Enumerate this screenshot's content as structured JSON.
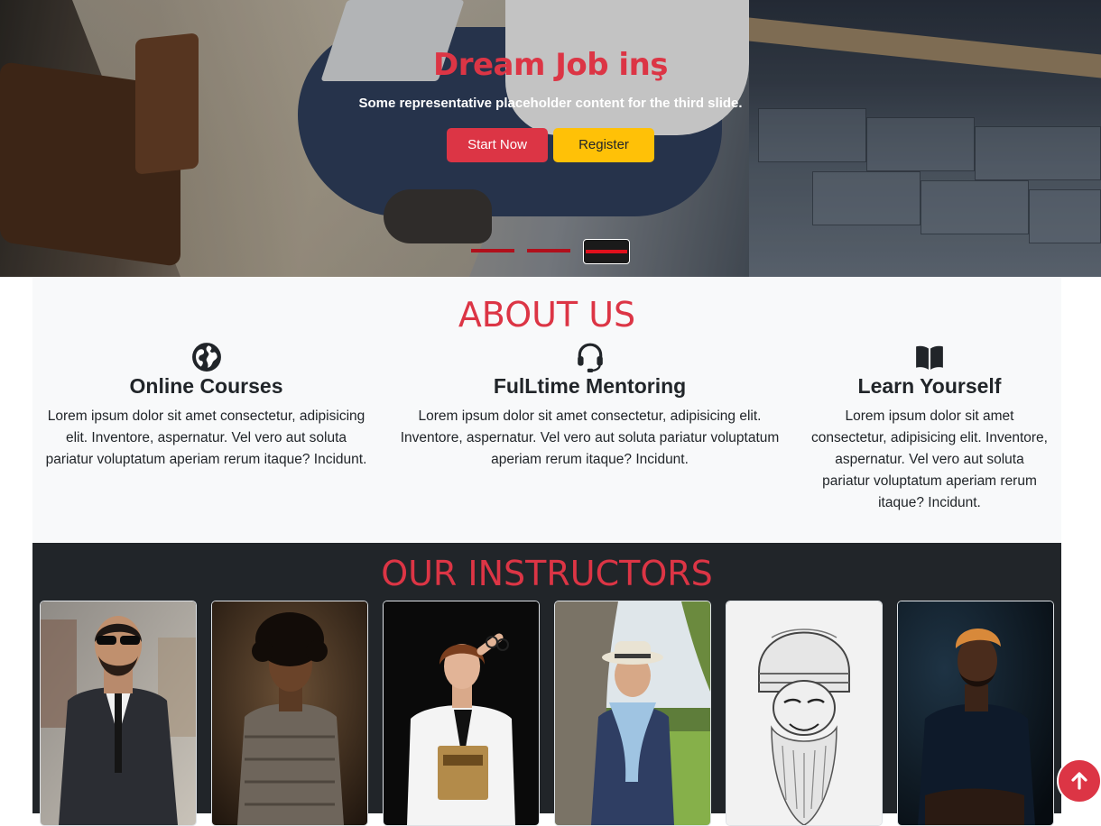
{
  "hero": {
    "title": "Dream Job inş",
    "subtitle": "Some representative placeholder content for the third slide.",
    "start_label": "Start Now",
    "register_label": "Register",
    "indicators": [
      "slide-1",
      "slide-2",
      "slide-3"
    ],
    "active_indicator": 3
  },
  "about": {
    "title": "ABOUT US",
    "features": [
      {
        "icon": "globe-icon",
        "title": "Online Courses",
        "text": "Lorem ipsum dolor sit amet consectetur, adipisicing elit. Inventore, aspernatur. Vel vero aut soluta pariatur voluptatum aperiam rerum itaque? Incidunt."
      },
      {
        "icon": "headset-icon",
        "title": "FulLtime Mentoring",
        "text": "Lorem ipsum dolor sit amet consectetur, adipisicing elit. Inventore, aspernatur. Vel vero aut soluta pariatur voluptatum aperiam rerum itaque? Incidunt."
      },
      {
        "icon": "book-icon",
        "title": "Learn Yourself",
        "text": "Lorem ipsum dolor sit amet consectetur, adipisicing elit. Inventore, aspernatur. Vel vero aut soluta pariatur voluptatum aperiam rerum itaque? Incidunt."
      }
    ]
  },
  "instructors": {
    "title": "OUR INSTRUCTORS",
    "cards": [
      "man-in-suit-sunglasses",
      "man-curly-hair-shirt",
      "woman-white-shirt-book",
      "man-hat-scarf-tree",
      "sketch-bearded-man-beanie",
      "man-dark-shirt-orange-hair"
    ]
  },
  "colors": {
    "accent_red": "#dc3545",
    "warning_yellow": "#ffc107",
    "dark_bg": "#212529",
    "light_bg": "#f8f9fa"
  },
  "back_to_top_icon": "arrow-up-icon"
}
